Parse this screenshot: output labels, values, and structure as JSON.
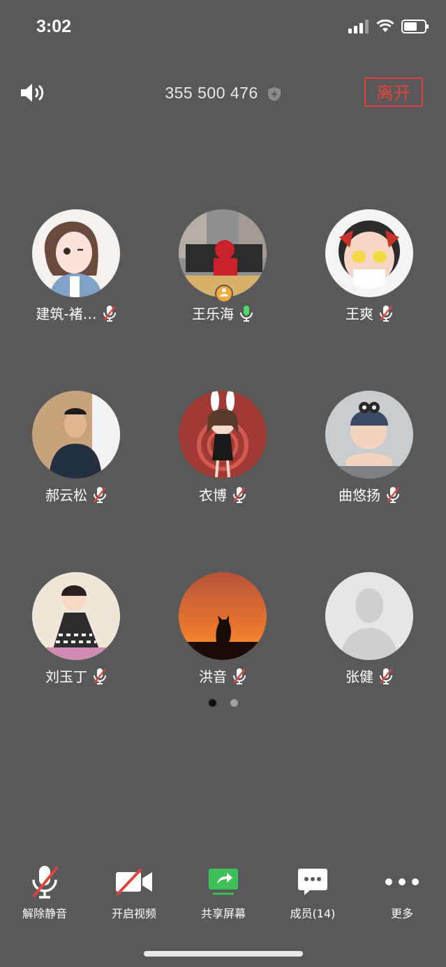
{
  "status_bar": {
    "time": "3:02"
  },
  "header": {
    "meeting_id": "355 500 476",
    "leave_label": "离开"
  },
  "participants": [
    {
      "name": "建筑-褚…",
      "mic": "muted",
      "host": false
    },
    {
      "name": "王乐海",
      "mic": "on",
      "host": true
    },
    {
      "name": "王爽",
      "mic": "muted",
      "host": false
    },
    {
      "name": "郝云松",
      "mic": "muted",
      "host": false
    },
    {
      "name": "衣博",
      "mic": "muted",
      "host": false
    },
    {
      "name": "曲悠扬",
      "mic": "muted",
      "host": false
    },
    {
      "name": "刘玉丁",
      "mic": "muted",
      "host": false
    },
    {
      "name": "洪音",
      "mic": "muted",
      "host": false
    },
    {
      "name": "张健",
      "mic": "muted",
      "host": false
    }
  ],
  "pager": {
    "pages": 2,
    "current": 1
  },
  "toolbar": {
    "unmute_label": "解除静音",
    "video_label": "开启视频",
    "share_label": "共享屏幕",
    "members_label": "成员(14)",
    "more_label": "更多"
  },
  "colors": {
    "background": "#595959",
    "leave": "#e0453d",
    "mic_on": "#4cd964",
    "share": "#3fbf5a",
    "muted_slash": "#e0453d"
  }
}
